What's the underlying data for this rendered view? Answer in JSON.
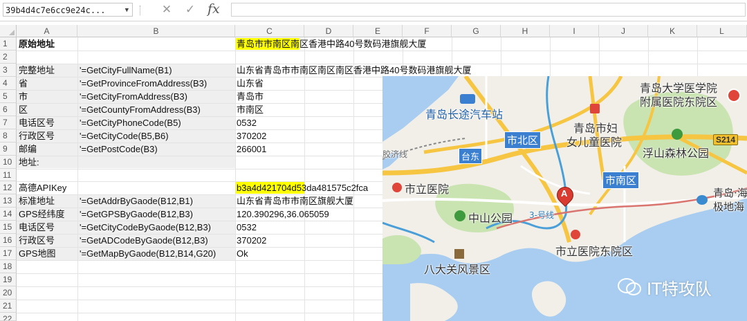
{
  "formula_bar": {
    "name_box": "39b4d4c7e6cc9e24c...",
    "cancel_symbol": "✕",
    "enter_symbol": "✓",
    "fx_symbol": "fx",
    "formula": ""
  },
  "columns": [
    "A",
    "B",
    "C",
    "D",
    "E",
    "F",
    "G",
    "H",
    "I",
    "J",
    "K",
    "L"
  ],
  "rows": [
    "1",
    "2",
    "3",
    "4",
    "5",
    "6",
    "7",
    "8",
    "9",
    "10",
    "11",
    "12",
    "13",
    "14",
    "15",
    "16",
    "17",
    "18",
    "19",
    "20",
    "21",
    "22"
  ],
  "cells": {
    "r1": {
      "a": "原始地址",
      "c_hl": "青岛市市南区",
      "c_rest": "南区香港中路40号数码港旗舰大厦"
    },
    "r3": {
      "a": "完整地址",
      "b": "'=GetCityFullName(B1)",
      "c": "山东省青岛市市南区南区南区香港中路40号数码港旗舰大厦"
    },
    "r4": {
      "a": "省",
      "b": "'=GetProvinceFromAddress(B3)",
      "c": "山东省"
    },
    "r5": {
      "a": "市",
      "b": "'=GetCityFromAddress(B3)",
      "c": "青岛市"
    },
    "r6": {
      "a": "区",
      "b": "'=GetCountyFromAddress(B3)",
      "c": "市南区"
    },
    "r7": {
      "a": "电话区号",
      "b": "'=GetCityPhoneCode(B5)",
      "c": "0532"
    },
    "r8": {
      "a": "行政区号",
      "b": "'=GetCityCode(B5,B6)",
      "c": "370202"
    },
    "r9": {
      "a": "邮编",
      "b": "'=GetPostCode(B3)",
      "c": "266001"
    },
    "r10": {
      "a": "地址:"
    },
    "r12": {
      "a": "高德APIKey",
      "c_hl": "b3a4d421704d",
      "c_rest": "53da481575c2fca"
    },
    "r13": {
      "a": "标准地址",
      "b": "'=GetAddrByGaode(B12,B1)",
      "c": "山东省青岛市市南区旗舰大厦"
    },
    "r14": {
      "a": "GPS经纬度",
      "b": "'=GetGPSByGaode(B12,B3)",
      "c": "120.390296,36.065059"
    },
    "r15": {
      "a": "电话区号",
      "b": "'=GetCityCodeByGaode(B12,B3)",
      "c": "0532"
    },
    "r16": {
      "a": "行政区号",
      "b": "'=GetADCodeByGaode(B12,B3)",
      "c": "370202"
    },
    "r17": {
      "a": "GPS地图",
      "b": "'=GetMapByGaode(B12,B14,G20)",
      "c": "Ok"
    }
  },
  "map": {
    "labels": {
      "bus_station": "青岛长途汽车站",
      "university_hospital": "青岛大学医学院",
      "university_hospital_2": "附属医院东院区",
      "women_children_1": "青岛市妇",
      "women_children_2": "女儿童医院",
      "shibei": "市北区",
      "taidong": "台东",
      "fushan_park": "浮山森林公园",
      "shinan": "市南区",
      "city_hospital": "市立医院",
      "zhongshan_park": "中山公园",
      "city_hospital_east": "市立医院东院区",
      "badaguan": "八大关风景区",
      "polar": "青岛·海",
      "polar_2": "极地海",
      "jiaoji": "胶济线",
      "road_badge": "S214",
      "marker": "A",
      "route_label": "3-号线",
      "watermark": "IT特攻队"
    },
    "colors": {
      "land": "#f1efe8",
      "water": "#a8cdf0",
      "park": "#c9e3b1",
      "highway": "#f6c542",
      "metro": "#4a9fd8",
      "rail": "#d9746f"
    }
  }
}
